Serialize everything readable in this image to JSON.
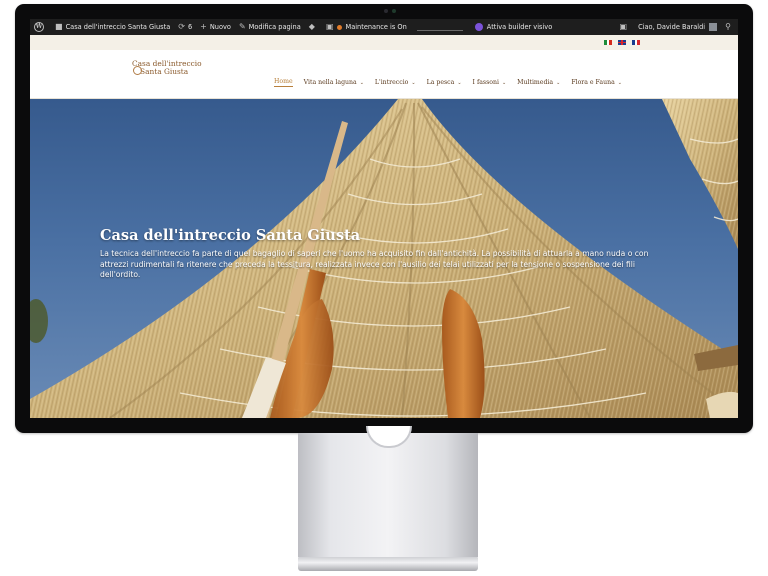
{
  "adminbar": {
    "site_name": "Casa dell'intreccio Santa Giusta",
    "updates_count": "6",
    "new_label": "Nuovo",
    "edit_label": "Modifica pagina",
    "maintenance_label": "Maintenance is On",
    "builder_label": "Attiva builder visivo",
    "greeting": "Ciao, Davide Baraldi"
  },
  "languages": [
    {
      "name": "italian-flag",
      "colors": [
        "#1e8c3a",
        "#ffffff",
        "#d52b1e"
      ]
    },
    {
      "name": "english-flag",
      "colors": [
        "#1c3d8f",
        "#ffffff",
        "#d9262c"
      ]
    },
    {
      "name": "french-flag",
      "colors": [
        "#1c3d8f",
        "#ffffff",
        "#d9262c"
      ]
    }
  ],
  "header": {
    "logo_line1": "Casa dell'intreccio",
    "logo_line2": "Santa Giusta",
    "nav": [
      {
        "label": "Home",
        "active": true,
        "dropdown": false
      },
      {
        "label": "Vita nella laguna",
        "active": false,
        "dropdown": true
      },
      {
        "label": "L'intreccio",
        "active": false,
        "dropdown": true
      },
      {
        "label": "La pesca",
        "active": false,
        "dropdown": true
      },
      {
        "label": "I fassoni",
        "active": false,
        "dropdown": true
      },
      {
        "label": "Multimedia",
        "active": false,
        "dropdown": true
      },
      {
        "label": "Flora e Fauna",
        "active": false,
        "dropdown": true
      }
    ]
  },
  "hero": {
    "title": "Casa dell'intreccio Santa Giusta",
    "text": "La tecnica dell'intreccio fa parte di quel bagaglio di saperi che l'uomo ha acquisito fin dall'antichità. La possibilità di attuarla a mano nuda o con attrezzi rudimentali fa ritenere che preceda la tessitura, realizzata invece con l'ausilio dei telai utilizzati per la tensione o sospensione dei fili dell'ordito."
  },
  "colors": {
    "adminbar_bg": "#1e1e1e",
    "accent": "#b8803c",
    "nav_text": "#5a3a1e",
    "flagbar_bg": "#f4f0e7"
  }
}
